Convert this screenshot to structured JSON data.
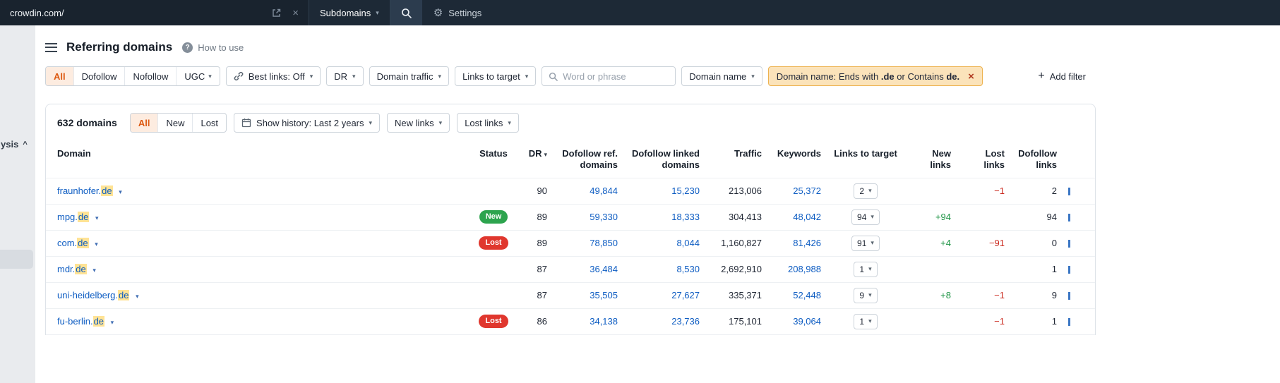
{
  "colors": {
    "link_blue": "#0d5cc2",
    "accent_orange": "#dd5a12",
    "segment_selected_bg": "#fdece0",
    "chip_bg": "#fbe3ba",
    "chip_border": "#edb24f",
    "highlight_yellow": "#ffe395",
    "positive_green": "#1e9445",
    "negative_red": "#cb2b20",
    "badge_new_green": "#2da44e",
    "badge_lost_red": "#e0372e"
  },
  "icons": {
    "menu": "menu-bars",
    "help": "?",
    "external_link": "open-in-new",
    "clear_url": "×",
    "search": "magnifier",
    "gear": "⚙",
    "best_links": "chain",
    "calendar": "calendar",
    "caret_down": "▾",
    "sidebar_collapse": "^",
    "chip_close": "×",
    "add": "+"
  },
  "topbar": {
    "url": "crowdin.com/",
    "subdomains_label": "Subdomains",
    "settings_label": "Settings"
  },
  "sidebar": {
    "partial_label": "ysis"
  },
  "page": {
    "title": "Referring domains",
    "help_label": "How to use"
  },
  "filter_bar": {
    "segments": [
      {
        "label": "All",
        "selected": true
      },
      {
        "label": "Dofollow",
        "selected": false
      },
      {
        "label": "Nofollow",
        "selected": false
      },
      {
        "label": "UGC",
        "selected": false
      }
    ],
    "best_links_label": "Best links: Off",
    "dr_label": "DR",
    "domain_traffic_label": "Domain traffic",
    "links_to_target_label": "Links to target",
    "search_placeholder": "Word or phrase",
    "domain_name_label": "Domain name",
    "active_filter": {
      "part1": "Domain name: Ends with ",
      "bold1": ".de",
      "part2": " or Contains ",
      "bold2": "de."
    },
    "add_filter_label": "Add filter"
  },
  "toolbar": {
    "count_label": "632 domains",
    "segments": [
      {
        "label": "All",
        "selected": true
      },
      {
        "label": "New",
        "selected": false
      },
      {
        "label": "Lost",
        "selected": false
      }
    ],
    "show_history_label": "Show history: Last 2 years",
    "new_links_label": "New links",
    "lost_links_label": "Lost links"
  },
  "table": {
    "headers": [
      "Domain",
      "Status",
      "DR",
      "Dofollow ref. domains",
      "Dofollow linked domains",
      "Traffic",
      "Keywords",
      "Links to target",
      "New links",
      "Lost links",
      "Dofollow links"
    ],
    "rows": [
      {
        "domain": "fraunhofer.",
        "match": "de",
        "status": "",
        "dr": "90",
        "dofollow_ref": "49,844",
        "dofollow_linked": "15,230",
        "traffic": "213,006",
        "keywords": "25,372",
        "links_to_target": "2",
        "new_links": "",
        "lost_links": "−1",
        "dofollow_links": "2"
      },
      {
        "domain": "mpg.",
        "match": "de",
        "status": "New",
        "dr": "89",
        "dofollow_ref": "59,330",
        "dofollow_linked": "18,333",
        "traffic": "304,413",
        "keywords": "48,042",
        "links_to_target": "94",
        "new_links": "+94",
        "lost_links": "",
        "dofollow_links": "94"
      },
      {
        "domain": "com.",
        "match": "de",
        "status": "Lost",
        "dr": "89",
        "dofollow_ref": "78,850",
        "dofollow_linked": "8,044",
        "traffic": "1,160,827",
        "keywords": "81,426",
        "links_to_target": "91",
        "new_links": "+4",
        "lost_links": "−91",
        "dofollow_links": "0"
      },
      {
        "domain": "mdr.",
        "match": "de",
        "status": "",
        "dr": "87",
        "dofollow_ref": "36,484",
        "dofollow_linked": "8,530",
        "traffic": "2,692,910",
        "keywords": "208,988",
        "links_to_target": "1",
        "new_links": "",
        "lost_links": "",
        "dofollow_links": "1"
      },
      {
        "domain": "uni-heidelberg.",
        "match": "de",
        "status": "",
        "dr": "87",
        "dofollow_ref": "35,505",
        "dofollow_linked": "27,627",
        "traffic": "335,371",
        "keywords": "52,448",
        "links_to_target": "9",
        "new_links": "+8",
        "lost_links": "−1",
        "dofollow_links": "9"
      },
      {
        "domain": "fu-berlin.",
        "match": "de",
        "status": "Lost",
        "dr": "86",
        "dofollow_ref": "34,138",
        "dofollow_linked": "23,736",
        "traffic": "175,101",
        "keywords": "39,064",
        "links_to_target": "1",
        "new_links": "",
        "lost_links": "−1",
        "dofollow_links": "1"
      }
    ]
  }
}
